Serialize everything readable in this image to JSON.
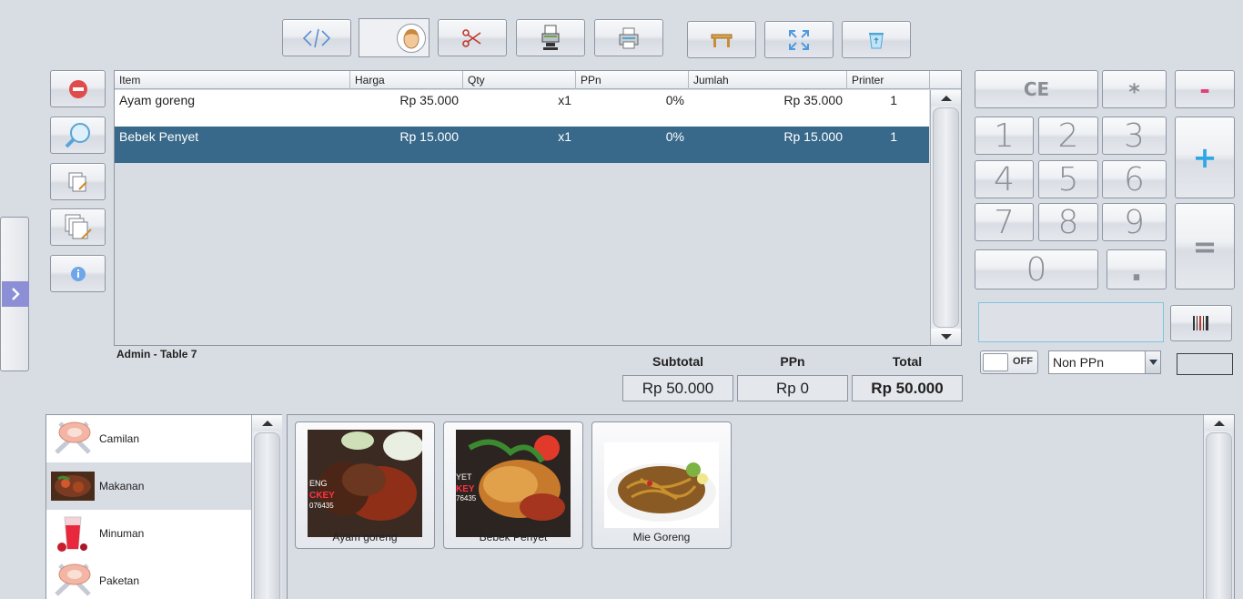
{
  "toolbar": {
    "buttons": [
      {
        "icon": "code-icon"
      },
      {
        "icon": "customer-avatar-icon"
      },
      {
        "icon": "scissors-icon"
      },
      {
        "icon": "print-receipt-icon"
      },
      {
        "icon": "printer-icon"
      },
      {
        "icon": "table-icon"
      },
      {
        "icon": "fullscreen-icon"
      },
      {
        "icon": "recycle-bin-icon"
      }
    ]
  },
  "side_actions": [
    {
      "icon": "delete-line-icon"
    },
    {
      "icon": "search-icon"
    },
    {
      "icon": "edit-line-icon"
    },
    {
      "icon": "edit-multiple-icon"
    },
    {
      "icon": "info-icon"
    }
  ],
  "ticket": {
    "columns": [
      "Item",
      "Harga",
      "Qty",
      "PPn",
      "Jumlah",
      "Printer"
    ],
    "rows": [
      {
        "item": "Ayam goreng",
        "harga": "Rp 35.000",
        "qty": "x1",
        "ppn": "0%",
        "jumlah": "Rp 35.000",
        "printer": "1",
        "selected": false
      },
      {
        "item": "Bebek Penyet",
        "harga": "Rp 15.000",
        "qty": "x1",
        "ppn": "0%",
        "jumlah": "Rp 15.000",
        "printer": "1",
        "selected": true
      }
    ],
    "status": "Admin - Table 7"
  },
  "summary": {
    "subtotal_label": "Subtotal",
    "ppn_label": "PPn",
    "total_label": "Total",
    "subtotal": "Rp 50.000",
    "ppn": "Rp 0",
    "total": "Rp 50.000"
  },
  "keypad": {
    "ce": "CE",
    "multiply": "*",
    "minus": "-",
    "plus": "+",
    "equals": "=",
    "digits": [
      "1",
      "2",
      "3",
      "4",
      "5",
      "6",
      "7",
      "8",
      "9",
      "0",
      "."
    ]
  },
  "input": {
    "barcode_value": "",
    "toggle_label": "OFF",
    "tax_select": "Non PPn"
  },
  "categories": [
    {
      "label": "Camilan",
      "icon": "meat-icon",
      "selected": false
    },
    {
      "label": "Makanan",
      "icon": "dish-icon",
      "selected": true
    },
    {
      "label": "Minuman",
      "icon": "drink-icon",
      "selected": false
    },
    {
      "label": "Paketan",
      "icon": "meat-icon",
      "selected": false
    }
  ],
  "products": [
    {
      "label": "Ayam goreng"
    },
    {
      "label": "Bebek Penyet"
    },
    {
      "label": "Mie Goreng"
    }
  ],
  "colors": {
    "background": "#d8dce3",
    "selection": "#39698a",
    "plus_accent": "#2fa7e6",
    "minus_accent": "#e0407c",
    "delete_red": "#e04b4b"
  }
}
